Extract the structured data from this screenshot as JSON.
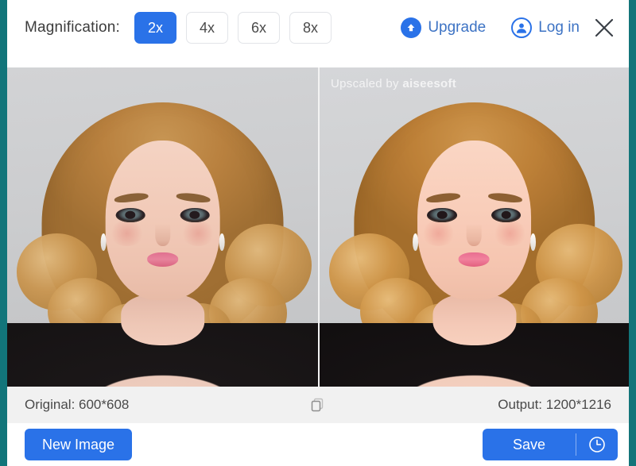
{
  "window": {
    "accent_color": "#2a72e8",
    "page_edge_color": "#12757a"
  },
  "header": {
    "magnification_label": "Magnification:",
    "magnification_options": [
      {
        "label": "2x",
        "active": true
      },
      {
        "label": "4x",
        "active": false
      },
      {
        "label": "6x",
        "active": false
      },
      {
        "label": "8x",
        "active": false
      }
    ],
    "upgrade_label": "Upgrade",
    "login_label": "Log in",
    "upgrade_icon": "upload-circle-icon",
    "login_icon": "user-circle-icon",
    "close_icon": "close-icon"
  },
  "compare": {
    "watermark_prefix": "Upscaled by ",
    "watermark_brand": "aiseesoft",
    "left_pane_name": "original-image",
    "right_pane_name": "upscaled-image"
  },
  "info_bar": {
    "original_label": "Original: 600*608",
    "output_label": "Output: 1200*1216",
    "compare_icon": "copy-icon"
  },
  "actions": {
    "new_image_label": "New Image",
    "save_label": "Save",
    "history_icon": "clock-icon"
  }
}
